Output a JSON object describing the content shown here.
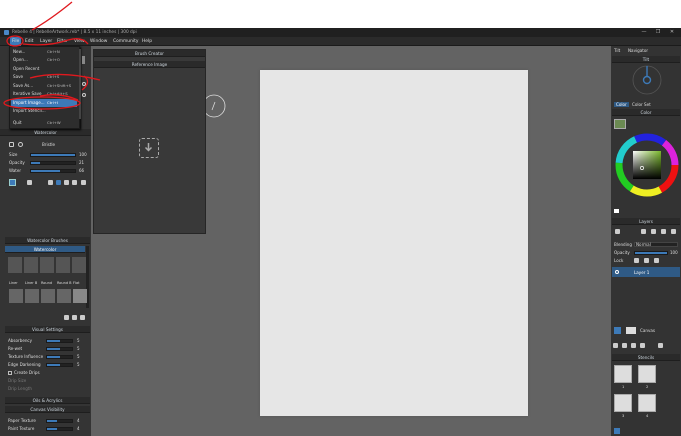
{
  "title_bar": {
    "text": "Rebelle 4 | RebelleArtwork.reb* | 8.5 x 11 inches | 300 dpi",
    "minimize": "—",
    "maximize": "❐",
    "close": "✕"
  },
  "menu": {
    "file": "File",
    "edit": "Edit",
    "layer": "Layer",
    "filter": "Filter",
    "view": "View",
    "window": "Window",
    "community": "Community",
    "help": "Help"
  },
  "file_menu": [
    {
      "label": "New...",
      "shortcut": "Ctrl+N"
    },
    {
      "label": "Open...",
      "shortcut": "Ctrl+O"
    },
    {
      "label": "Open Recent",
      "shortcut": ""
    },
    {
      "label": "Save",
      "shortcut": "Ctrl+S"
    },
    {
      "label": "Save As...",
      "shortcut": "Ctrl+Shift+S"
    },
    {
      "label": "Iterative Save",
      "shortcut": "Ctrl+Alt+S"
    },
    {
      "label": "Import Image...",
      "shortcut": "Ctrl+I"
    },
    {
      "label": "Import Stencil...",
      "shortcut": ""
    },
    {
      "label": "Quit",
      "shortcut": "Ctrl+W"
    }
  ],
  "watercolor_panel": {
    "title": "Watercolor",
    "brush_name": "Bristle",
    "size_label": "Size",
    "size_value": "100",
    "size_fraction": 1.0,
    "opacity_label": "Opacity",
    "opacity_value": "21",
    "opacity_fraction": 0.21,
    "water_label": "Water",
    "water_value": "66",
    "water_fraction": 0.66
  },
  "brushes_panel": {
    "title": "Watercolor Brushes",
    "category": "Watercolor",
    "row_labels": [
      "Liner",
      "Liner B",
      "Round",
      "Round B",
      "Flat"
    ]
  },
  "visual_settings": {
    "title": "Visual Settings",
    "rows": [
      {
        "label": "Absorbency",
        "value": "5",
        "fraction": 0.5
      },
      {
        "label": "Re-wet",
        "value": "5",
        "fraction": 0.5
      },
      {
        "label": "Texture Influence",
        "value": "5",
        "fraction": 0.5
      },
      {
        "label": "Edge Darkening",
        "value": "5",
        "fraction": 0.5
      }
    ],
    "create_drips": "Create Drips",
    "drip_size": "Drip Size",
    "drip_length": "Drip Length",
    "oils_acrylics": "Oils & Acrylics"
  },
  "canvas_visibility": {
    "title": "Canvas Visibility",
    "paper_texture_label": "Paper Texture",
    "paper_texture_value": "4",
    "paper_texture_fraction": 0.4,
    "paint_texture_label": "Paint Texture",
    "paint_texture_value": "4",
    "paint_texture_fraction": 0.4
  },
  "brush_creator": {
    "title": "Brush Creator"
  },
  "reference_image": {
    "title": "Reference Image"
  },
  "right_tabs": {
    "tilt": "Tilt",
    "navigator": "Navigator",
    "tilt_title": "Tilt"
  },
  "color_panel": {
    "tab_color": "Color",
    "tab_color_set": "Color Set",
    "title": "Color",
    "swatch": "#6b8a52"
  },
  "layers_panel": {
    "title": "Layers",
    "blending_label": "Blending",
    "blending_value": "Normal",
    "opacity_label": "Opacity",
    "opacity_value": "100",
    "opacity_fraction": 1.0,
    "lock_label": "Lock",
    "layer_name": "Layer 1",
    "canvas_label": "Canvas"
  },
  "stencils_panel": {
    "title": "Stencils",
    "counts": [
      "1",
      "2",
      "3",
      "4"
    ]
  },
  "colors": {
    "accent": "#3d7ab8",
    "annotation": "#e0191e"
  }
}
